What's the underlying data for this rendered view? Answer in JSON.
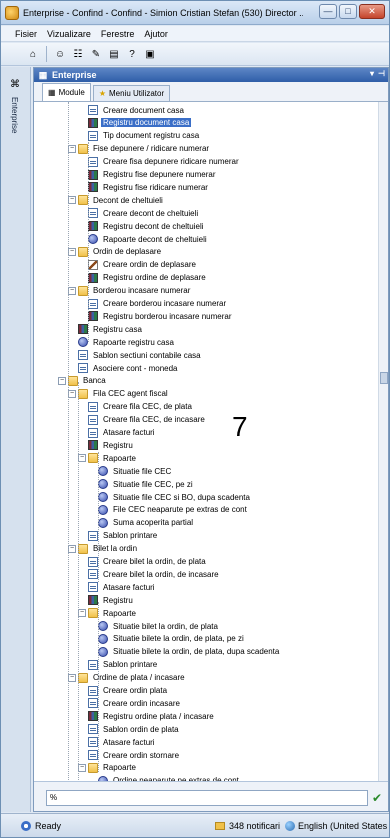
{
  "window": {
    "title": "Enterprise - Confind - Confind - Simion Cristian Stefan (530) Director ...",
    "controls": {
      "minimize": "—",
      "maximize": "□",
      "close": "✕"
    }
  },
  "menu": [
    "Fisier",
    "Vizualizare",
    "Ferestre",
    "Ajutor"
  ],
  "toolbar_icons": [
    "home-icon",
    "users-icon",
    "tree-icon",
    "pen-icon",
    "doc-icon",
    "help-icon",
    "window-icon"
  ],
  "sidebar": {
    "label": "Enterprise"
  },
  "panel": {
    "title": "Enterprise",
    "pin": "▾",
    "close": "⊣",
    "tabs": [
      {
        "label": "Module",
        "icon": "module-icon"
      },
      {
        "label": "Meniu Utilizator",
        "icon": "star-icon"
      }
    ]
  },
  "tree": [
    {
      "label": "Creare document casa",
      "icon": "doc",
      "level": 5
    },
    {
      "label": "Registru document casa",
      "icon": "book",
      "level": 5,
      "selected": true
    },
    {
      "label": "Tip document registru casa",
      "icon": "doc",
      "level": 5
    },
    {
      "label": "Fise depunere / ridicare numerar",
      "icon": "folder",
      "level": 4,
      "expander": "−"
    },
    {
      "label": "Creare fisa depunere ridicare numerar",
      "icon": "doc",
      "level": 5
    },
    {
      "label": "Registru fise depunere numerar",
      "icon": "book",
      "level": 5
    },
    {
      "label": "Registru fise ridicare numerar",
      "icon": "book",
      "level": 5
    },
    {
      "label": "Decont de cheltuieli",
      "icon": "folder",
      "level": 4,
      "expander": "−"
    },
    {
      "label": "Creare decont de cheltuieli",
      "icon": "doc",
      "level": 5
    },
    {
      "label": "Registru decont de cheltuieli",
      "icon": "book",
      "level": 5
    },
    {
      "label": "Rapoarte decont de cheltuieli",
      "icon": "report",
      "level": 5
    },
    {
      "label": "Ordin de deplasare",
      "icon": "folder",
      "level": 4,
      "expander": "−"
    },
    {
      "label": "Creare ordin de deplasare",
      "icon": "pen",
      "level": 5
    },
    {
      "label": "Registru ordine de deplasare",
      "icon": "book",
      "level": 5
    },
    {
      "label": "Borderou incasare numerar",
      "icon": "folder",
      "level": 4,
      "expander": "−"
    },
    {
      "label": "Creare borderou incasare numerar",
      "icon": "doc",
      "level": 5
    },
    {
      "label": "Registru borderou incasare numerar",
      "icon": "book",
      "level": 5
    },
    {
      "label": "Registru casa",
      "icon": "book",
      "level": 4
    },
    {
      "label": "Rapoarte registru casa",
      "icon": "report",
      "level": 4
    },
    {
      "label": "Sablon sectiuni contabile casa",
      "icon": "doc",
      "level": 4
    },
    {
      "label": "Asociere cont - moneda",
      "icon": "doc",
      "level": 4
    },
    {
      "label": "Banca",
      "icon": "folder",
      "level": 3,
      "expander": "−"
    },
    {
      "label": "Fila CEC agent fiscal",
      "icon": "folder",
      "level": 4,
      "expander": "−"
    },
    {
      "label": "Creare fila CEC, de plata",
      "icon": "doc",
      "level": 5
    },
    {
      "label": "Creare fila CEC, de incasare",
      "icon": "doc",
      "level": 5
    },
    {
      "label": "Atasare facturi",
      "icon": "doc",
      "level": 5
    },
    {
      "label": "Registru",
      "icon": "book",
      "level": 5
    },
    {
      "label": "Rapoarte",
      "icon": "folder",
      "level": 5,
      "expander": "−"
    },
    {
      "label": "Situatie file CEC",
      "icon": "report",
      "level": 6
    },
    {
      "label": "Situatie file CEC, pe zi",
      "icon": "report",
      "level": 6
    },
    {
      "label": "Situatie file CEC si BO, dupa scadenta",
      "icon": "report",
      "level": 6
    },
    {
      "label": "File CEC neaparute pe extras de cont",
      "icon": "report",
      "level": 6
    },
    {
      "label": "Suma acoperita partial",
      "icon": "report",
      "level": 6
    },
    {
      "label": "Sablon printare",
      "icon": "doc",
      "level": 5
    },
    {
      "label": "Bilet la ordin",
      "icon": "folder",
      "level": 4,
      "expander": "−"
    },
    {
      "label": "Creare bilet la ordin, de plata",
      "icon": "doc",
      "level": 5
    },
    {
      "label": "Creare bilet la ordin, de incasare",
      "icon": "doc",
      "level": 5
    },
    {
      "label": "Atasare facturi",
      "icon": "doc",
      "level": 5
    },
    {
      "label": "Registru",
      "icon": "book",
      "level": 5
    },
    {
      "label": "Rapoarte",
      "icon": "folder",
      "level": 5,
      "expander": "−"
    },
    {
      "label": "Situatie bilet la ordin, de plata",
      "icon": "report",
      "level": 6
    },
    {
      "label": "Situatie bilete la ordin, de plata, pe zi",
      "icon": "report",
      "level": 6
    },
    {
      "label": "Situatie bilete la ordin, de plata, dupa scadenta",
      "icon": "report",
      "level": 6
    },
    {
      "label": "Sablon printare",
      "icon": "doc",
      "level": 5
    },
    {
      "label": "Ordine de plata / incasare",
      "icon": "folder",
      "level": 4,
      "expander": "−"
    },
    {
      "label": "Creare ordin plata",
      "icon": "doc",
      "level": 5
    },
    {
      "label": "Creare ordin incasare",
      "icon": "doc",
      "level": 5
    },
    {
      "label": "Registru ordine plata / incasare",
      "icon": "book",
      "level": 5
    },
    {
      "label": "Sablon ordin de plata",
      "icon": "doc",
      "level": 5
    },
    {
      "label": "Atasare facturi",
      "icon": "doc",
      "level": 5
    },
    {
      "label": "Creare ordin stornare",
      "icon": "doc",
      "level": 5
    },
    {
      "label": "Rapoarte",
      "icon": "folder",
      "level": 5,
      "expander": "−"
    },
    {
      "label": "Ordine neaparute pe extras de cont",
      "icon": "report",
      "level": 6
    }
  ],
  "overlay_text": "7",
  "filter": {
    "value": "%",
    "ok": "✔"
  },
  "status": {
    "ready": "Ready",
    "notifications": "348 notificari",
    "language": "English (United States"
  }
}
